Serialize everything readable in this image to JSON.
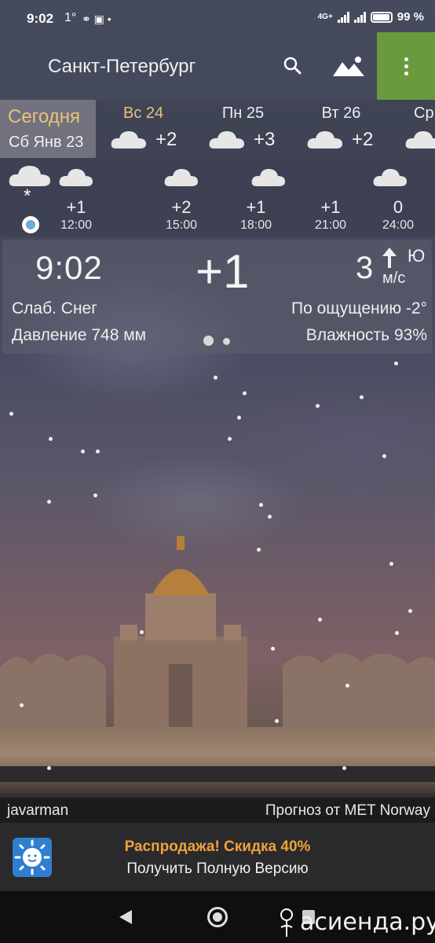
{
  "status_bar": {
    "time": "9:02",
    "temp": "1°",
    "battery": "99 %",
    "network": "4G+"
  },
  "toolbar": {
    "city": "Санкт-Петербург"
  },
  "days": {
    "today_label": "Сегодня",
    "today_date": "Сб Янв 23",
    "items": [
      {
        "name": "Вс 24",
        "temp": "+2",
        "icon": "cloud-icon"
      },
      {
        "name": "Пн 25",
        "temp": "+3",
        "icon": "cloud-icon"
      },
      {
        "name": "Вт 26",
        "temp": "+2",
        "icon": "cloud-icon"
      },
      {
        "name": "Ср",
        "temp": "",
        "icon": "cloud-icon"
      }
    ]
  },
  "hours": {
    "now_icon": "snow-cloud-icon",
    "items": [
      {
        "temp": "+1",
        "time": "12:00",
        "icon": "cloud-icon"
      },
      {
        "temp": "+2",
        "time": "15:00",
        "icon": "cloud-icon"
      },
      {
        "temp": "+1",
        "time": "18:00",
        "icon": "cloud-icon"
      },
      {
        "temp": "+1",
        "time": "21:00",
        "icon": "cloud-icon"
      },
      {
        "temp": "0",
        "time": "24:00",
        "icon": "cloud-icon"
      }
    ]
  },
  "current": {
    "time": "9:02",
    "temp": "+1",
    "wind_speed": "3",
    "wind_dir": "Ю",
    "wind_unit": "м/с",
    "condition": "Слаб. Снег",
    "feels_like": "По ощущению -2°",
    "pressure": "Давление 748 мм",
    "humidity": "Влажность 93%"
  },
  "credits": {
    "author": "javarman",
    "forecast_by": "Прогноз от MET Norway"
  },
  "promo": {
    "title": "Распродажа! Скидка 40%",
    "subtitle": "Получить Полную Версию"
  },
  "watermark": "асиенда.ру",
  "colors": {
    "accent_green": "#6a9a3e",
    "today_gold": "#e8c27a",
    "promo_orange": "#f0a23a"
  }
}
